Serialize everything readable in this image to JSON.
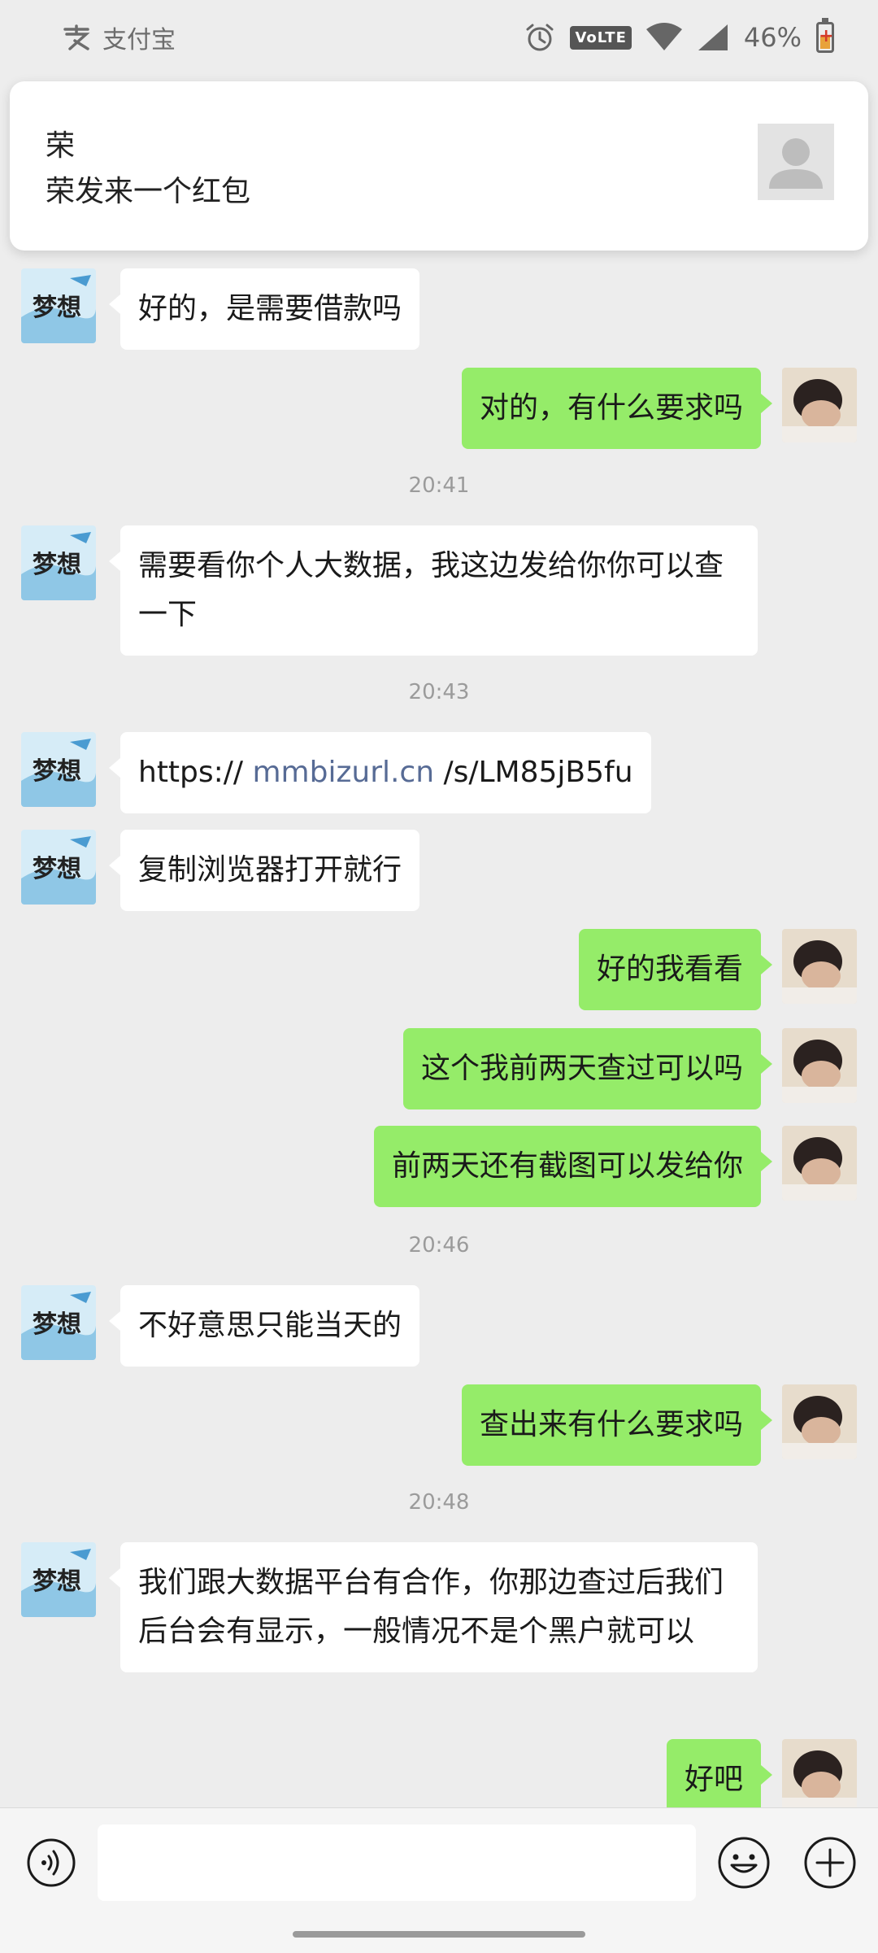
{
  "status_bar": {
    "app_name": "支付宝",
    "volte": "VoLTE",
    "battery": "46%",
    "battery_level": 0.46
  },
  "notification": {
    "title": "荣",
    "text": "荣发来一个红包"
  },
  "chat": {
    "m1": "好的，是需要借款吗",
    "m2": "对的，有什么要求吗",
    "t1": "20:41",
    "m3": "需要看你个人大数据，我这边发给你你可以查一下",
    "t2": "20:43",
    "m4_pre": "https:// ",
    "m4_link": "mmbizurl.cn",
    "m4_post": " /s/LM85jB5fu",
    "m5": "复制浏览器打开就行",
    "m6": "好的我看看",
    "m7": "这个我前两天查过可以吗",
    "m8": "前两天还有截图可以发给你",
    "t3": "20:46",
    "m9": "不好意思只能当天的",
    "m10": "查出来有什么要求吗",
    "t4": "20:48",
    "m11": "我们跟大数据平台有合作，你那边查过后我们后台会有显示，一般情况不是个黑户就可以",
    "m12": "好吧"
  },
  "colors": {
    "outgoing_bubble": "#95ec69",
    "incoming_bubble": "#ffffff",
    "background": "#ededed",
    "link": "#576b95"
  }
}
